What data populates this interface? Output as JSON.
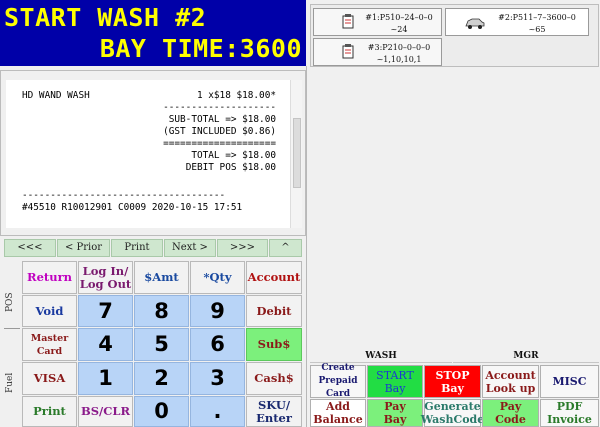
{
  "header": {
    "line1": "START WASH #2",
    "line2": "BAY TIME:3600"
  },
  "receipt": {
    "item_name": "HD WAND WASH",
    "item_qty": "1 x$18 $18.00*",
    "sep1": "--------------------",
    "subtotal": "SUB-TOTAL => $18.00",
    "gst": "(GST INCLUDED $0.86)",
    "sep2": "====================",
    "total": "TOTAL => $18.00",
    "debit": "DEBIT POS $18.00",
    "sep3": "------------------------------------",
    "footer": "#45510 R10012901 C0009 2020-10-15 17:51"
  },
  "nav": {
    "first": "<<<",
    "prior": "< Prior",
    "print": "Print",
    "next": "Next >",
    "last": ">>>",
    "up": "^"
  },
  "side_labels": {
    "pos": "POS",
    "fuel": "Fuel"
  },
  "keypad": {
    "return": "Return",
    "login1": "Log In/",
    "login2": "Log Out",
    "samt": "$Amt",
    "qty": "*Qty",
    "account": "Account",
    "void": "Void",
    "debit": "Debit",
    "mastercard": "Master Card",
    "subs": "Sub$",
    "visa": "VISA",
    "cashs": "Cash$",
    "print": "Print",
    "bsclr": "BS/CLR",
    "sku1": "SKU/",
    "sku2": "Enter",
    "n7": "7",
    "n8": "8",
    "n9": "9",
    "n4": "4",
    "n5": "5",
    "n6": "6",
    "n1": "1",
    "n2": "2",
    "n3": "3",
    "n0": "0",
    "dot": "."
  },
  "bays": {
    "b1_l1": "#1:P510–24–0–0",
    "b1_l2": "~24",
    "b2_l1": "#2:P511–7–3600–0",
    "b2_l2": "~65",
    "b3_l1": "#3:P210–0–0–0",
    "b3_l2": "~1,10,10,1"
  },
  "tabs": {
    "wash": "WASH",
    "mgr": "MGR"
  },
  "wash_buttons": {
    "create1": "Create",
    "create2": "Prepaid Card",
    "start1": "START",
    "start2": "Bay",
    "stop1": "STOP",
    "stop2": "Bay",
    "acct1": "Account",
    "acct2": "Look up",
    "misc": "MISC",
    "add1": "Add",
    "add2": "Balance",
    "paybay1": "Pay",
    "paybay2": "Bay",
    "gen1": "Generate",
    "gen2": "WashCode",
    "paycode1": "Pay",
    "paycode2": "Code",
    "pdf1": "PDF",
    "pdf2": "Invoice"
  },
  "colors": {
    "header_bg": "#0000a8",
    "header_fg": "#ffff00",
    "num_key": "#b8d4f7",
    "green_key": "#7cf07c",
    "red_key": "#ff0000"
  }
}
